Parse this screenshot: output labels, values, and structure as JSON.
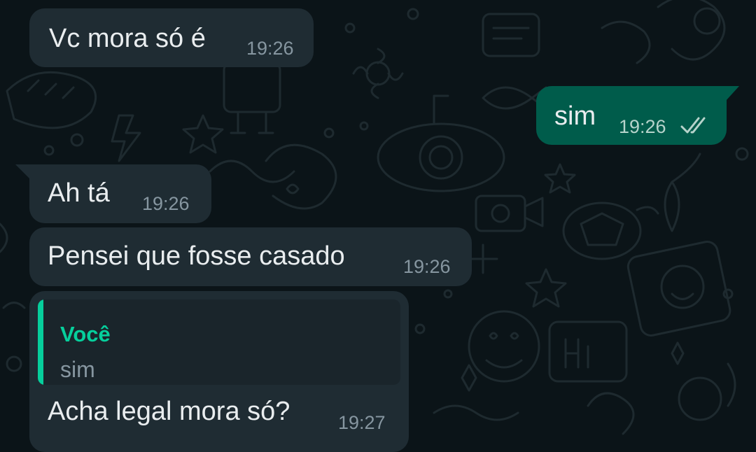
{
  "messages": [
    {
      "direction": "incoming",
      "text": "Vc mora só é",
      "time": "19:26"
    },
    {
      "direction": "outgoing",
      "text": "sim",
      "time": "19:26",
      "status": "read-double-check-icon"
    },
    {
      "direction": "incoming",
      "text": "Ah tá",
      "time": "19:26"
    },
    {
      "direction": "incoming",
      "text": "Pensei que fosse casado",
      "time": "19:26"
    },
    {
      "direction": "incoming",
      "quoted": {
        "author": "Você",
        "text": "sim"
      },
      "text": "Acha legal mora só?",
      "time": "19:27"
    }
  ],
  "colors": {
    "background": "#0b1418",
    "incoming_bubble": "#1f2c33",
    "outgoing_bubble": "#005c4b",
    "quote_accent": "#06cf9c",
    "text": "#e9edef",
    "meta": "#8696a0"
  }
}
